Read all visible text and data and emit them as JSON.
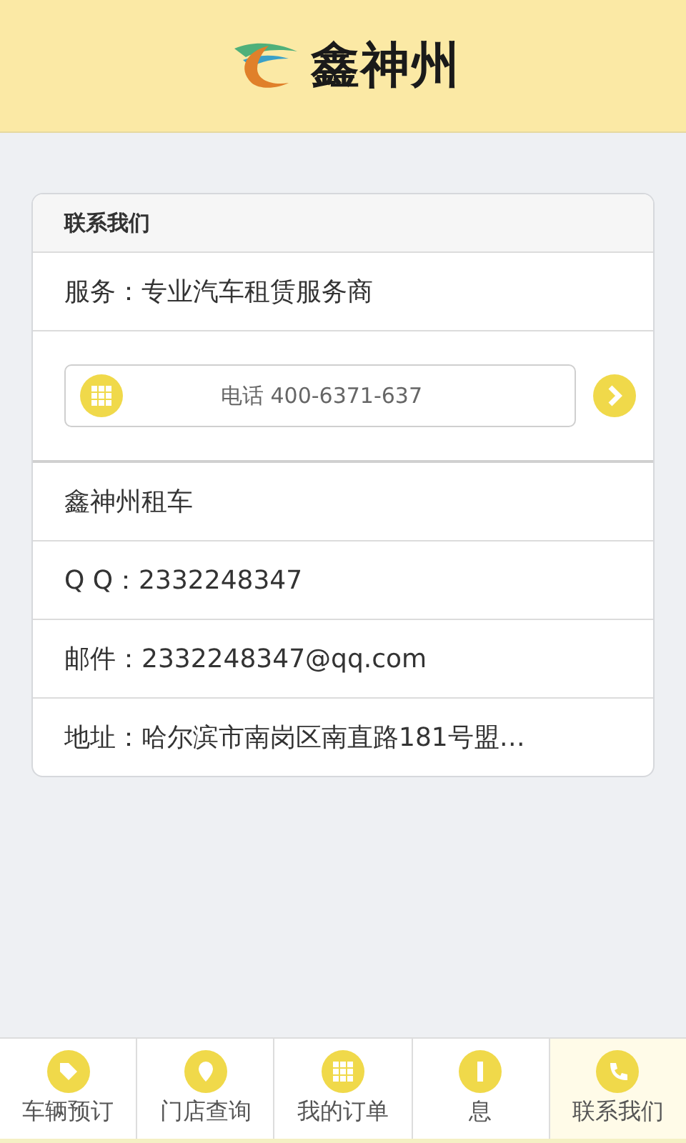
{
  "header": {
    "logo_text": "鑫神州"
  },
  "card": {
    "title": "联系我们",
    "service": "服务：专业汽车租赁服务商",
    "phone": {
      "label": "电话 400-6371-637"
    },
    "rows": [
      "鑫神州租车",
      "Q  Q：2332248347",
      "邮件：2332248347@qq.com",
      "地址：哈尔滨市南岗区南直路181号盟…"
    ]
  },
  "tabs": [
    {
      "kind": "tag",
      "label": "车辆预订",
      "selected": false
    },
    {
      "kind": "pin",
      "label": "门店查询",
      "selected": false
    },
    {
      "kind": "grid",
      "label": "我的订单",
      "selected": false
    },
    {
      "kind": "info",
      "label": "息",
      "selected": false
    },
    {
      "kind": "phone",
      "label": "联系我们",
      "selected": true
    }
  ]
}
